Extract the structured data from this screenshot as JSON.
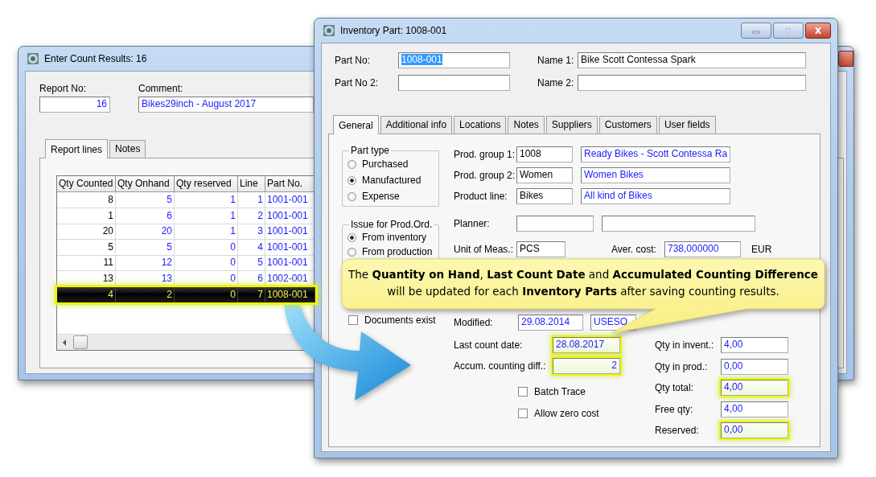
{
  "count_window": {
    "title": "Enter Count Results: 16",
    "report_no": {
      "label": "Report No:",
      "value": "16"
    },
    "comment": {
      "label": "Comment:",
      "value": "Bikes29inch - August 2017"
    },
    "tabs": [
      {
        "label": "Report lines",
        "selected": true
      },
      {
        "label": "Notes",
        "selected": false
      }
    ],
    "table": {
      "columns": [
        "Qty Counted",
        "Qty Onhand",
        "Qty reserved",
        "Line",
        "Part No."
      ],
      "rows": [
        {
          "cells": [
            "8",
            "5",
            "1",
            "1",
            "1001-001"
          ],
          "selected": false
        },
        {
          "cells": [
            "1",
            "6",
            "1",
            "2",
            "1001-001"
          ],
          "selected": false
        },
        {
          "cells": [
            "20",
            "20",
            "1",
            "3",
            "1001-001"
          ],
          "selected": false
        },
        {
          "cells": [
            "5",
            "5",
            "0",
            "4",
            "1001-001"
          ],
          "selected": false
        },
        {
          "cells": [
            "11",
            "12",
            "0",
            "5",
            "1001-001"
          ],
          "selected": false
        },
        {
          "cells": [
            "13",
            "13",
            "0",
            "6",
            "1002-001"
          ],
          "selected": false
        },
        {
          "cells": [
            "4",
            "2",
            "0",
            "7",
            "1008-001"
          ],
          "selected": true
        }
      ]
    }
  },
  "part_window": {
    "title": "Inventory Part: 1008-001",
    "part_no": {
      "label": "Part No:",
      "value": "1008-001",
      "text_selected": true
    },
    "part_no_2": {
      "label": "Part No 2:"
    },
    "name_1": {
      "label": "Name 1:",
      "value": "Bike Scott Contessa Spark"
    },
    "name_2": {
      "label": "Name 2:"
    },
    "tabs": [
      {
        "label": "General",
        "selected": true
      },
      {
        "label": "Additional info",
        "selected": false
      },
      {
        "label": "Locations",
        "selected": false
      },
      {
        "label": "Notes",
        "selected": false
      },
      {
        "label": "Suppliers",
        "selected": false
      },
      {
        "label": "Customers",
        "selected": false
      },
      {
        "label": "User fields",
        "selected": false
      }
    ],
    "part_type": {
      "title": "Part type",
      "options": [
        {
          "label": "Purchased",
          "selected": false
        },
        {
          "label": "Manufactured",
          "selected": true
        },
        {
          "label": "Expense",
          "selected": false
        }
      ]
    },
    "issue": {
      "title": "Issue for Prod.Ord.",
      "options": [
        {
          "label": "From inventory",
          "selected": true
        },
        {
          "label": "From production",
          "selected": false
        }
      ]
    },
    "documents_exist": {
      "label": "Documents exist",
      "checked": false
    },
    "groups": [
      {
        "label": "Prod. group 1:",
        "code": "1008",
        "description": "Ready Bikes - Scott Contessa Ra"
      },
      {
        "label": "Prod. group 2:",
        "code": "Women",
        "description": "Women Bikes"
      },
      {
        "label": "Product line:",
        "code": "Bikes",
        "description": "All kind of Bikes"
      }
    ],
    "planner": {
      "label": "Planner:"
    },
    "unit": {
      "label": "Unit of Meas.:",
      "value": "PCS"
    },
    "aver_cost": {
      "label": "Aver. cost:",
      "value": "738,000000",
      "currency": "EUR"
    },
    "modified": {
      "label": "Modified:",
      "date": "29.08.2014",
      "user": "USESO"
    },
    "counts": [
      {
        "label": "Last count date:",
        "value": "28.08.2017",
        "kind": "date",
        "highlighted": true
      },
      {
        "label": "Accum. counting diff.:",
        "value": "2",
        "kind": "number",
        "highlighted": true
      }
    ],
    "checkboxes": [
      {
        "label": "Batch Trace",
        "checked": false
      },
      {
        "label": "Allow zero cost",
        "checked": false
      }
    ],
    "quantities": [
      {
        "label": "Qty in invent.:",
        "value": "4,00",
        "highlighted": false
      },
      {
        "label": "Qty in prod.:",
        "value": "0,00",
        "highlighted": false
      },
      {
        "label": "Qty total:",
        "value": "4,00",
        "highlighted": true
      },
      {
        "label": "Free qty:",
        "value": "4,00",
        "highlighted": false
      },
      {
        "label": "Reserved:",
        "value": "0,00",
        "highlighted": true
      }
    ]
  },
  "callout": {
    "lines": [
      "The **Quantity on Hand**, **Last Count Date** and **Accumulated Counting Difference**",
      "will be updated for each **Inventory Parts** after saving counting results."
    ]
  }
}
